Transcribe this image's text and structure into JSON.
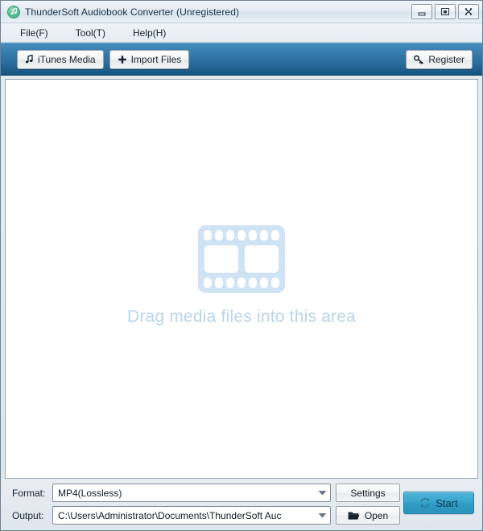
{
  "window": {
    "title": "ThunderSoft Audiobook Converter (Unregistered)",
    "app_icon": "music-note-app-icon",
    "accent_color": "#2a6d9f",
    "start_color": "#2e9bc4",
    "drop_text_color": "#b9d4ec",
    "controls": {
      "minimize": "minimize-icon",
      "maximize": "maximize-icon",
      "close": "close-icon"
    }
  },
  "menubar": {
    "items": [
      {
        "label": "File(F)",
        "name": "menu-file"
      },
      {
        "label": "Tool(T)",
        "name": "menu-tool"
      },
      {
        "label": "Help(H)",
        "name": "menu-help"
      }
    ]
  },
  "toolbar": {
    "itunes_media_label": "iTunes Media",
    "itunes_media_icon": "music-note-icon",
    "import_files_label": "Import Files",
    "import_files_icon": "plus-icon",
    "register_label": "Register",
    "register_icon": "key-icon"
  },
  "main": {
    "drop_icon": "film-strip-icon",
    "drop_hint": "Drag media files into this area"
  },
  "bottom": {
    "format_label": "Format:",
    "format_value": "MP4(Lossless)",
    "settings_label": "Settings",
    "output_label": "Output:",
    "output_value": "C:\\Users\\Administrator\\Documents\\ThunderSoft Auc",
    "open_label": "Open",
    "open_icon": "folder-icon",
    "start_label": "Start",
    "start_icon": "refresh-convert-icon",
    "dropdown_icon": "chevron-down-icon"
  }
}
